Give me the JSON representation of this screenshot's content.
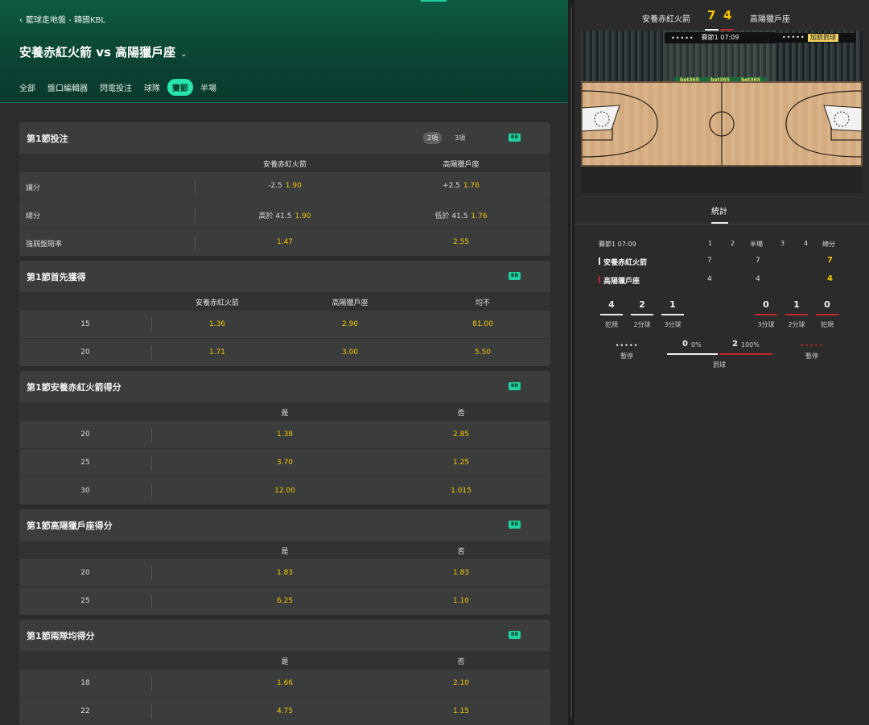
{
  "header": {
    "breadcrumb": "籃球走地盤 - 韓國KBL",
    "title": "安養赤紅火箭 vs 高陽獵戶座",
    "tabs": [
      {
        "label": "全部"
      },
      {
        "label": "盤口編輯器"
      },
      {
        "label": "閃電投注"
      },
      {
        "label": "球隊"
      },
      {
        "label": "賽節",
        "active": true
      },
      {
        "label": "半場"
      }
    ]
  },
  "markets": [
    {
      "title": "第1節投注",
      "options": [
        "2項",
        "3項"
      ],
      "selected_option": "2項",
      "badge": "BB",
      "columns": [
        "安養赤紅火箭",
        "高陽獵戶座"
      ],
      "rows": [
        {
          "label": "讓分",
          "cells": [
            {
              "hc": "-2.5",
              "odds": "1.90"
            },
            {
              "hc": "+2.5",
              "odds": "1.76"
            }
          ]
        },
        {
          "label": "總分",
          "cells": [
            {
              "hc": "高於 41.5",
              "odds": "1.90"
            },
            {
              "hc": "低於 41.5",
              "odds": "1.76"
            }
          ]
        },
        {
          "label": "強弱盤賠率",
          "cells": [
            {
              "hc": "",
              "odds": "1.47"
            },
            {
              "hc": "",
              "odds": "2.55"
            }
          ]
        }
      ]
    },
    {
      "title": "第1節首先獲得",
      "badge": "BB",
      "columns": [
        "安養赤紅火箭",
        "高陽獵戶座",
        "均不"
      ],
      "rows": [
        {
          "category": "15",
          "odds": [
            "1.36",
            "2.90",
            "81.00"
          ]
        },
        {
          "category": "20",
          "odds": [
            "1.71",
            "3.00",
            "5.50"
          ]
        }
      ]
    },
    {
      "title": "第1節安養赤紅火箭得分",
      "badge": "BB",
      "columns": [
        "是",
        "否"
      ],
      "rows": [
        {
          "category": "20",
          "odds": [
            "1.38",
            "2.85"
          ]
        },
        {
          "category": "25",
          "odds": [
            "3.70",
            "1.25"
          ]
        },
        {
          "category": "30",
          "odds": [
            "12.00",
            "1.015"
          ]
        }
      ]
    },
    {
      "title": "第1節高陽獵戶座得分",
      "badge": "BB",
      "columns": [
        "是",
        "否"
      ],
      "rows": [
        {
          "category": "20",
          "odds": [
            "1.83",
            "1.83"
          ]
        },
        {
          "category": "25",
          "odds": [
            "6.25",
            "1.10"
          ]
        }
      ]
    },
    {
      "title": "第1節兩隊均得分",
      "badge": "BB",
      "columns": [
        "是",
        "否"
      ],
      "rows": [
        {
          "category": "18",
          "odds": [
            "1.66",
            "2.10"
          ]
        },
        {
          "category": "22",
          "odds": [
            "4.75",
            "1.15"
          ]
        }
      ]
    }
  ],
  "scoreboard": {
    "home": "安養赤紅火箭",
    "away": "高陽獵戶座",
    "home_score": "7",
    "away_score": "4"
  },
  "court": {
    "clock": "賽節1 07:09",
    "event": "加罰罰球",
    "sponsor": "bet365"
  },
  "stats": {
    "tab": "統計",
    "period_clock": "賽節1 07:09",
    "headers": [
      "1",
      "2",
      "半場",
      "3",
      "4",
      "總分"
    ],
    "teams": [
      {
        "name": "安養赤紅火箭",
        "q1": "7",
        "half": "7",
        "total": "7",
        "color": "#eeeeee"
      },
      {
        "name": "高陽獵戶座",
        "q1": "4",
        "half": "4",
        "total": "4",
        "color": "#c0262a"
      }
    ],
    "home_stats": [
      {
        "value": "4",
        "label": "犯規"
      },
      {
        "value": "2",
        "label": "2分球"
      },
      {
        "value": "1",
        "label": "3分球"
      }
    ],
    "away_stats": [
      {
        "value": "0",
        "label": "3分球"
      },
      {
        "value": "1",
        "label": "2分球"
      },
      {
        "value": "0",
        "label": "犯規"
      }
    ],
    "timeouts_label": "暫停",
    "free_throws": {
      "home": "0",
      "home_pct": "0%",
      "away": "2",
      "away_pct": "100%",
      "label": "罰球"
    }
  },
  "colors": {
    "accent": "#27e5ac",
    "odds": "#f2c400",
    "away_team": "#c0262a"
  }
}
